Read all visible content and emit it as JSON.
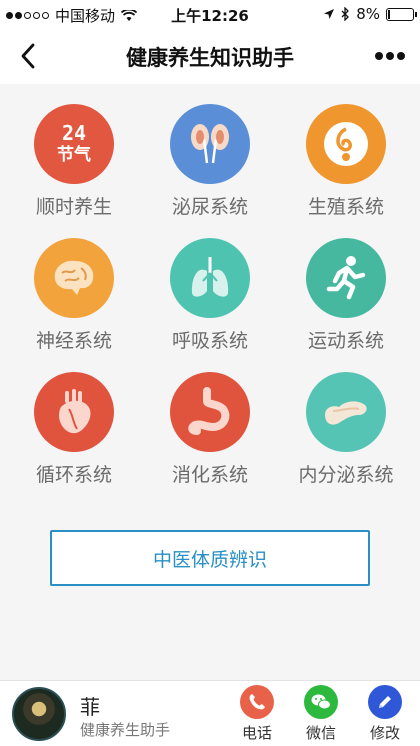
{
  "status_bar": {
    "carrier": "中国移动",
    "time": "上午12:26",
    "battery": "8%",
    "battery_level": 0.08
  },
  "nav": {
    "title": "健康养生知识助手",
    "back_icon": "chevron-left-icon",
    "more_icon": "more-dots-icon"
  },
  "tiles": [
    {
      "label": "顺时养生",
      "color": "#e2573f",
      "icon": "solar-terms-icon",
      "badge_line1": "24",
      "badge_line2": "节气"
    },
    {
      "label": "泌尿系统",
      "color": "#5a8fd8",
      "icon": "kidney-icon"
    },
    {
      "label": "生殖系统",
      "color": "#f0962e",
      "icon": "reproductive-icon"
    },
    {
      "label": "神经系统",
      "color": "#f3a33c",
      "icon": "brain-icon"
    },
    {
      "label": "呼吸系统",
      "color": "#4ec3b0",
      "icon": "lungs-icon"
    },
    {
      "label": "运动系统",
      "color": "#45b89f",
      "icon": "running-icon"
    },
    {
      "label": "循环系统",
      "color": "#e0543e",
      "icon": "heart-icon"
    },
    {
      "label": "消化系统",
      "color": "#e0543e",
      "icon": "stomach-icon"
    },
    {
      "label": "内分泌系统",
      "color": "#56c4b4",
      "icon": "pancreas-icon"
    }
  ],
  "constitution_button": "中医体质辨识",
  "footer": {
    "name": "菲",
    "subtitle": "健康养生助手",
    "actions": [
      {
        "label": "电话",
        "color": "#e8624a",
        "icon": "phone-icon"
      },
      {
        "label": "微信",
        "color": "#2db93e",
        "icon": "wechat-icon"
      },
      {
        "label": "修改",
        "color": "#2f58d8",
        "icon": "edit-icon"
      }
    ]
  }
}
